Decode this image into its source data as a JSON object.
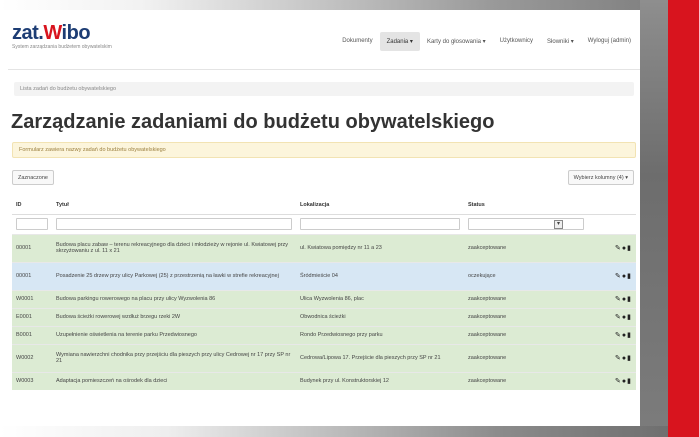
{
  "brand": {
    "logo_pre": "zat.",
    "logo_red": "W",
    "logo_post": "ibo",
    "tagline": "System zarządzania budżetem obywatelskim"
  },
  "nav": [
    "Dokumenty",
    "Zadania ▾",
    "Karty do głosowania ▾",
    "Użytkownicy",
    "Słowniki ▾",
    "Wyloguj (admin)"
  ],
  "breadcrumb": "Lista zadań do budżetu obywatelskiego",
  "title": "Zarządzanie zadaniami do budżetu obywatelskiego",
  "alert": "Formularz zawiera nazwy zadań do budżetu obywatelskiego",
  "toolbar": {
    "left": "Zaznaczone",
    "right": "Wybierz kolumny (4) ▾"
  },
  "table": {
    "headers": [
      "ID",
      "Tytuł",
      "Lokalizacja",
      "Status",
      ""
    ],
    "rows": [
      {
        "id": "00001",
        "title": "Budowa placu zabaw – terenu rekreacyjnego dla dzieci i młodzieży w rejonie ul. Kwiatowej przy skrzyżowaniu z ul. 11 x 21",
        "loc": "ul. Kwiatowa pomiędzy nr 11 a 23",
        "status": "zaakceptowane",
        "style": "green"
      },
      {
        "id": "00001",
        "title": "Posadzenie 25 drzew przy ulicy Parkowej (25) z przestrzenią na ławki w strefie rekreacyjnej",
        "loc": "Śródmieście 04",
        "status": "oczekujące",
        "style": "blue"
      },
      {
        "id": "W0001",
        "title": "Budowa parkingu rowerowego na placu przy ulicy Wyzwolenia 86",
        "loc": "Ulica Wyzwolenia 86, plac",
        "status": "zaakceptowane",
        "style": "green"
      },
      {
        "id": "E0001",
        "title": "Budowa ścieżki rowerowej wzdłuż brzegu rzeki 2W",
        "loc": "Obwodnica ścieżki",
        "status": "zaakceptowane",
        "style": "green"
      },
      {
        "id": "B0001",
        "title": "Uzupełnienie oświetlenia na terenie parku Przedwiosnego",
        "loc": "Rondo Przedwiosnego przy parku",
        "status": "zaakceptowane",
        "style": "green"
      },
      {
        "id": "W0002",
        "title": "Wymiana nawierzchni chodnika przy przejściu dla pieszych przy ulicy Cedrowej nr 17 przy SP nr 21",
        "loc": "Cedrowa/Lipowa 17. Przejście dla pieszych przy SP nr 21",
        "status": "zaakceptowane",
        "style": "green"
      },
      {
        "id": "W0003",
        "title": "Adaptacja pomieszczeń na ośrodek dla dzieci",
        "loc": "Budynek przy ul. Konstruktorskiej 12",
        "status": "zaakceptowane",
        "style": "green"
      }
    ]
  },
  "actions_glyph": "✎👁🗑"
}
